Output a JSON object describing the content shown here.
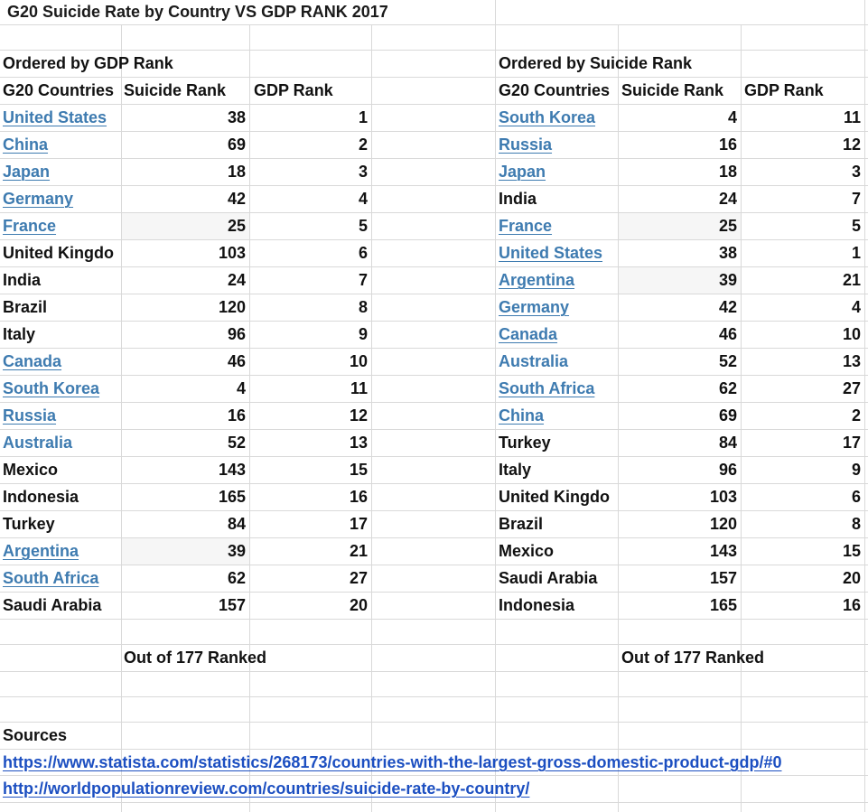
{
  "title": "G20 Suicide Rate by Country VS GDP RANK 2017",
  "left_table": {
    "caption": "Ordered by GDP Rank",
    "headers": [
      "G20 Countries",
      "Suicide Rank",
      "GDP Rank"
    ],
    "rows": [
      {
        "country": "United States",
        "suicide_rank": "38",
        "gdp_rank": "1",
        "link": true
      },
      {
        "country": "China",
        "suicide_rank": "69",
        "gdp_rank": "2",
        "link": true
      },
      {
        "country": "Japan",
        "suicide_rank": "18",
        "gdp_rank": "3",
        "link": true
      },
      {
        "country": "Germany",
        "suicide_rank": "42",
        "gdp_rank": "4",
        "link": true
      },
      {
        "country": "France",
        "suicide_rank": "25",
        "gdp_rank": "5",
        "link": true,
        "shaded": true
      },
      {
        "country": "United Kingdo",
        "suicide_rank": "103",
        "gdp_rank": "6",
        "link": false
      },
      {
        "country": "India",
        "suicide_rank": "24",
        "gdp_rank": "7",
        "link": false
      },
      {
        "country": "Brazil",
        "suicide_rank": "120",
        "gdp_rank": "8",
        "link": false
      },
      {
        "country": "Italy",
        "suicide_rank": "96",
        "gdp_rank": "9",
        "link": false
      },
      {
        "country": "Canada",
        "suicide_rank": "46",
        "gdp_rank": "10",
        "link": true
      },
      {
        "country": "South Korea",
        "suicide_rank": "4",
        "gdp_rank": "11",
        "link": true
      },
      {
        "country": "Russia",
        "suicide_rank": "16",
        "gdp_rank": "12",
        "link": true
      },
      {
        "country": "Australia",
        "suicide_rank": "52",
        "gdp_rank": "13",
        "link": true,
        "no_underline": true
      },
      {
        "country": "Mexico",
        "suicide_rank": "143",
        "gdp_rank": "15",
        "link": false
      },
      {
        "country": "Indonesia",
        "suicide_rank": "165",
        "gdp_rank": "16",
        "link": false
      },
      {
        "country": "Turkey",
        "suicide_rank": "84",
        "gdp_rank": "17",
        "link": false
      },
      {
        "country": "Argentina",
        "suicide_rank": "39",
        "gdp_rank": "21",
        "link": true,
        "shaded": true
      },
      {
        "country": "South Africa",
        "suicide_rank": "62",
        "gdp_rank": "27",
        "link": true
      },
      {
        "country": "Saudi Arabia",
        "suicide_rank": "157",
        "gdp_rank": "20",
        "link": false
      }
    ],
    "footnote": "Out of 177 Ranked"
  },
  "right_table": {
    "caption": "Ordered by Suicide Rank",
    "headers": [
      "G20 Countries",
      "Suicide Rank",
      "GDP Rank"
    ],
    "rows": [
      {
        "country": "South Korea",
        "suicide_rank": "4",
        "gdp_rank": "11",
        "link": true
      },
      {
        "country": "Russia",
        "suicide_rank": "16",
        "gdp_rank": "12",
        "link": true
      },
      {
        "country": "Japan",
        "suicide_rank": "18",
        "gdp_rank": "3",
        "link": true
      },
      {
        "country": "India",
        "suicide_rank": "24",
        "gdp_rank": "7",
        "link": false
      },
      {
        "country": "France",
        "suicide_rank": "25",
        "gdp_rank": "5",
        "link": true,
        "shaded": true
      },
      {
        "country": "United States",
        "suicide_rank": "38",
        "gdp_rank": "1",
        "link": true
      },
      {
        "country": "Argentina",
        "suicide_rank": "39",
        "gdp_rank": "21",
        "link": true,
        "shaded": true
      },
      {
        "country": "Germany",
        "suicide_rank": "42",
        "gdp_rank": "4",
        "link": true
      },
      {
        "country": "Canada",
        "suicide_rank": "46",
        "gdp_rank": "10",
        "link": true
      },
      {
        "country": "Australia",
        "suicide_rank": "52",
        "gdp_rank": "13",
        "link": true,
        "no_underline": true
      },
      {
        "country": "South Africa",
        "suicide_rank": "62",
        "gdp_rank": "27",
        "link": true
      },
      {
        "country": "China",
        "suicide_rank": "69",
        "gdp_rank": "2",
        "link": true
      },
      {
        "country": "Turkey",
        "suicide_rank": "84",
        "gdp_rank": "17",
        "link": false
      },
      {
        "country": "Italy",
        "suicide_rank": "96",
        "gdp_rank": "9",
        "link": false
      },
      {
        "country": "United Kingdo",
        "suicide_rank": "103",
        "gdp_rank": "6",
        "link": false
      },
      {
        "country": "Brazil",
        "suicide_rank": "120",
        "gdp_rank": "8",
        "link": false
      },
      {
        "country": "Mexico",
        "suicide_rank": "143",
        "gdp_rank": "15",
        "link": false
      },
      {
        "country": "Saudi Arabia",
        "suicide_rank": "157",
        "gdp_rank": "20",
        "link": false
      },
      {
        "country": "Indonesia",
        "suicide_rank": "165",
        "gdp_rank": "16",
        "link": false
      }
    ],
    "footnote": "Out of 177 Ranked"
  },
  "sources": {
    "label": "Sources",
    "links": [
      "https://www.statista.com/statistics/268173/countries-with-the-largest-gross-domestic-product-gdp/#0",
      "http://worldpopulationreview.com/countries/suicide-rate-by-country/"
    ]
  },
  "colors": {
    "link_country": "#3e7bb0",
    "link_source": "#1c4fc1",
    "gridline": "#d9d9d9",
    "text": "#111111"
  }
}
